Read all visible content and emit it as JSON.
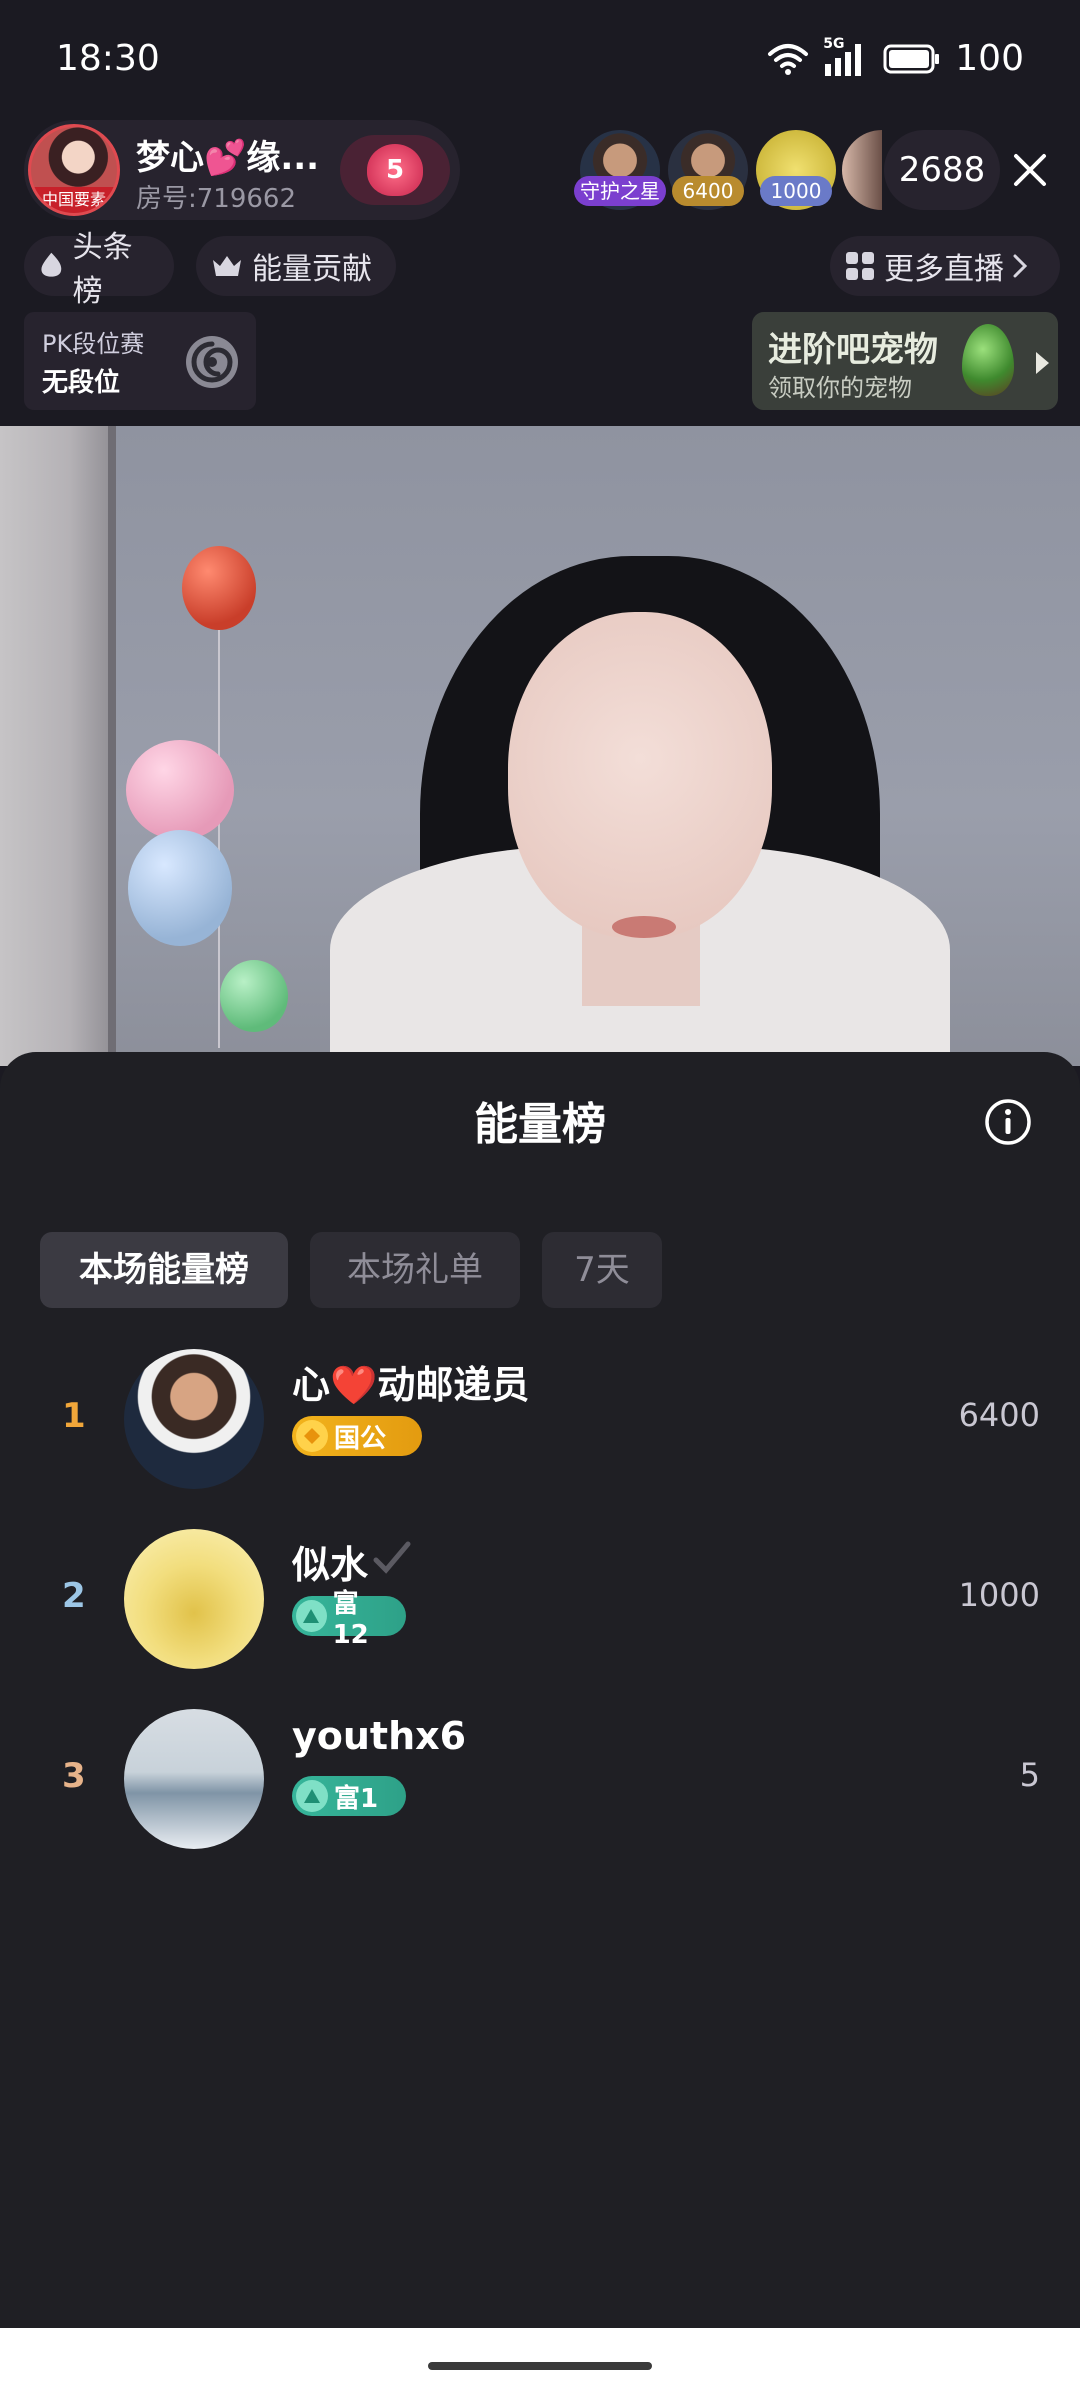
{
  "status_bar": {
    "time": "18:30",
    "network_label": "5G",
    "battery": "100"
  },
  "live_header": {
    "host_name": "梦心💕缘...",
    "room_id": "房号:719662",
    "host_avatar_badge": "中国要素",
    "like_count": "5",
    "viewer_tags": [
      "守护之星",
      "6400",
      "1000"
    ],
    "viewer_count": "2688",
    "chips": {
      "top": "头条榜",
      "energy": "能量贡献",
      "more": "更多直播"
    },
    "pk": {
      "title": "PK段位赛",
      "rank": "无段位"
    },
    "pet": {
      "title": "进阶吧宠物",
      "subtitle": "领取你的宠物"
    }
  },
  "sheet": {
    "title": "能量榜",
    "tabs": [
      {
        "label": "本场能量榜",
        "active": true
      },
      {
        "label": "本场礼单",
        "active": false
      },
      {
        "label": "7天",
        "active": false
      }
    ],
    "rows": [
      {
        "rank": "1",
        "name": "心❤️动邮递员",
        "badge": "国公",
        "score": "6400",
        "rank_color": "#f0a63a"
      },
      {
        "rank": "2",
        "name": "似水",
        "badge": "富12",
        "score": "1000",
        "rank_color": "#9cc6e6"
      },
      {
        "rank": "3",
        "name": "youthx6",
        "badge": "富1",
        "score": "5",
        "rank_color": "#e7b38a"
      }
    ]
  },
  "colors": {
    "sheet_bg": "#1f1f24",
    "accent_gold": "#f2b31c",
    "accent_green": "#36b59a"
  }
}
